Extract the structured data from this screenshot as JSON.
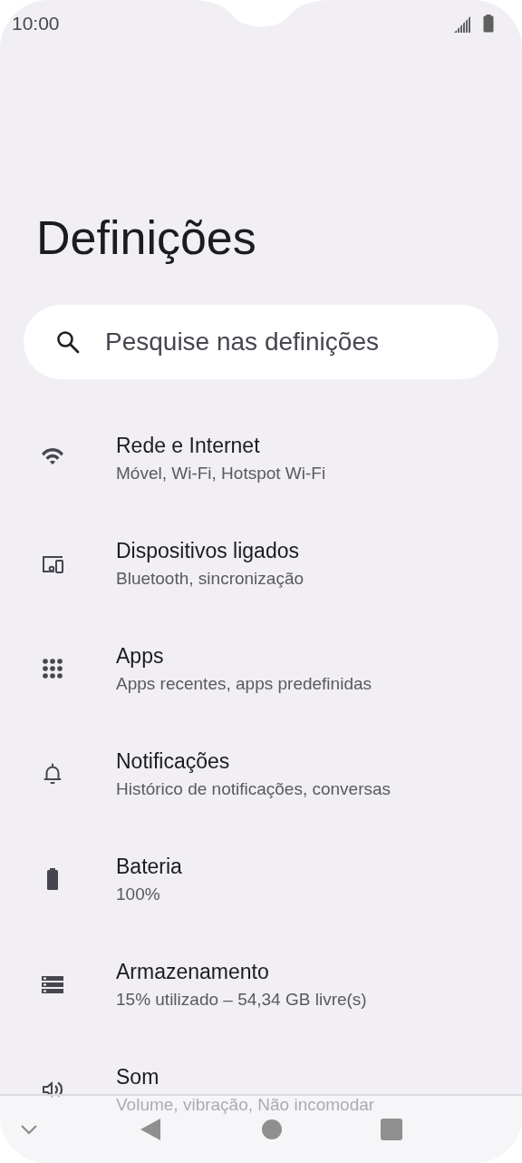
{
  "status_bar": {
    "time": "10:00"
  },
  "title": "Definições",
  "search": {
    "placeholder": "Pesquise nas definições"
  },
  "items": [
    {
      "kind": "wifi",
      "title": "Rede e Internet",
      "subtitle": "Móvel, Wi-Fi, Hotspot Wi-Fi"
    },
    {
      "kind": "devices",
      "title": "Dispositivos ligados",
      "subtitle": "Bluetooth, sincronização"
    },
    {
      "kind": "apps",
      "title": "Apps",
      "subtitle": "Apps recentes, apps predefinidas"
    },
    {
      "kind": "bell",
      "title": "Notificações",
      "subtitle": "Histórico de notificações, conversas"
    },
    {
      "kind": "battery",
      "title": "Bateria",
      "subtitle": "100%"
    },
    {
      "kind": "storage",
      "title": "Armazenamento",
      "subtitle": "15% utilizado – 54,34 GB livre(s)"
    },
    {
      "kind": "sound",
      "title": "Som",
      "subtitle": "Volume, vibração, Não incomodar"
    }
  ]
}
